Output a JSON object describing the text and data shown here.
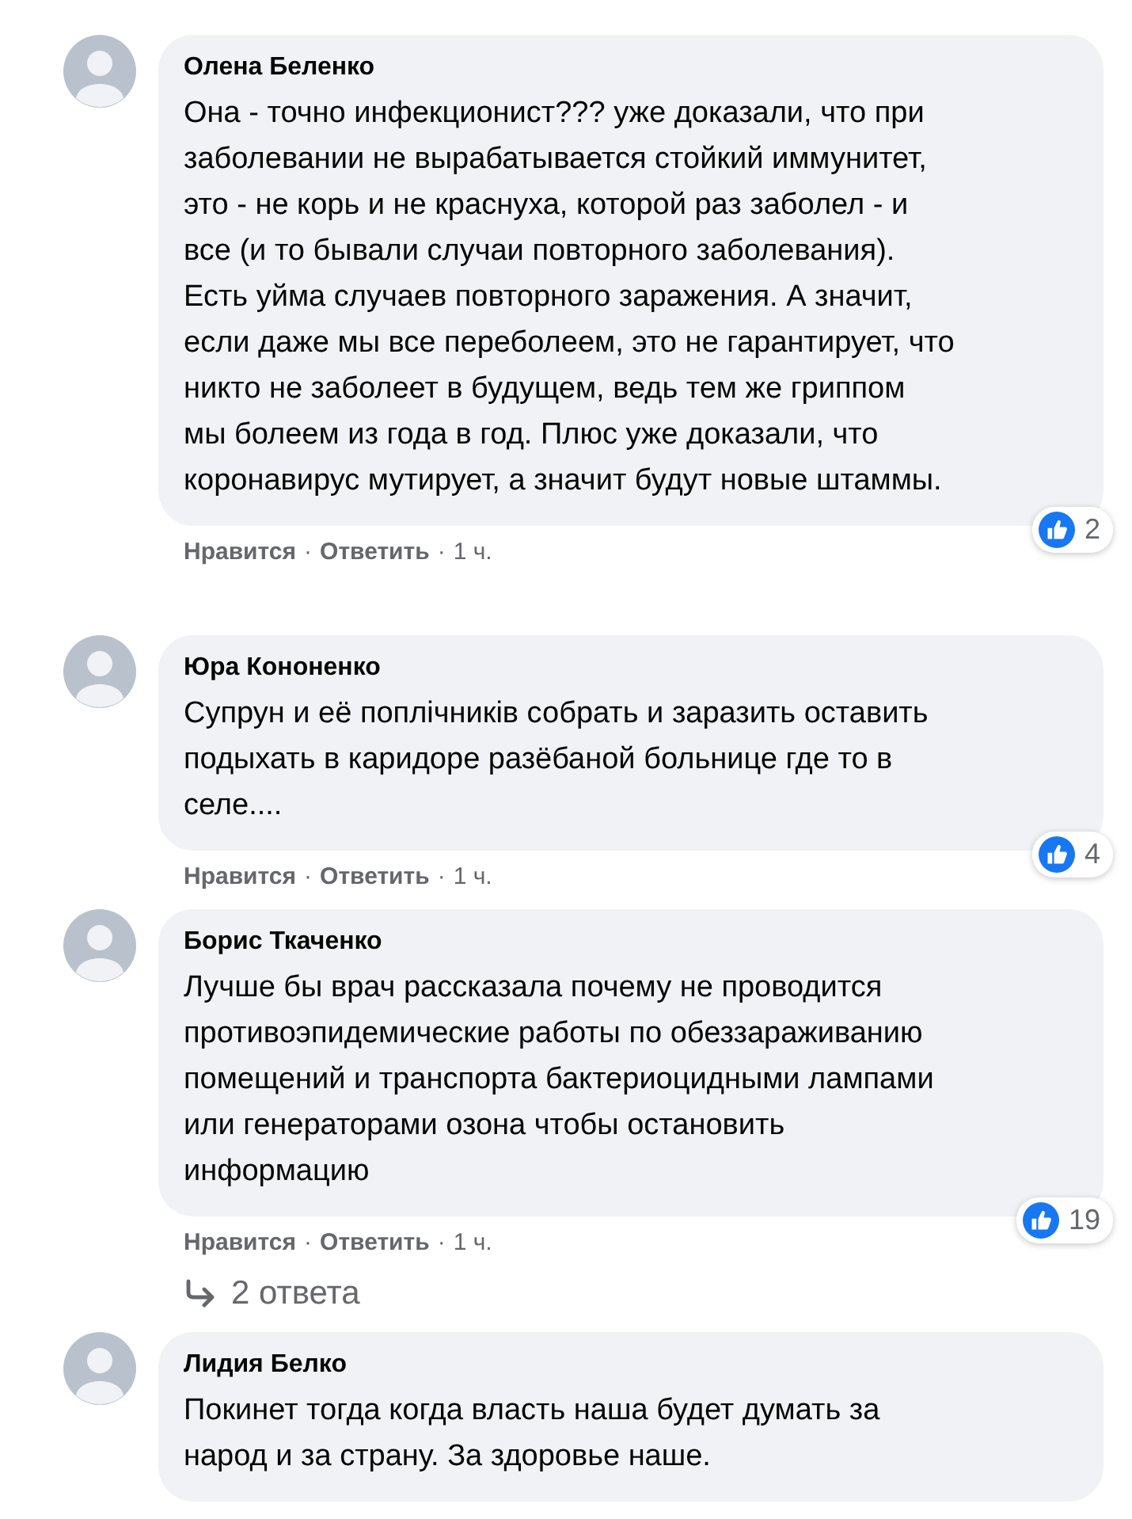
{
  "comments": [
    {
      "author": "Олена Беленко",
      "text": "Она - точно инфекционист??? уже доказали, что при\nзаболевании не вырабатывается стойкий иммунитет,\nэто - не корь и не краснуха, которой раз заболел - и\nвсе (и то бывали случаи повторного заболевания).\nЕсть уйма случаев повторного заражения. А значит,\nесли даже мы все переболеем, это не гарантирует, что\nникто не заболеет в будущем, ведь тем же гриппом\nмы болеем из года в год. Плюс уже доказали, что\nкоронавирус мутирует, а значит будут новые штаммы.",
      "reactions": "2",
      "actions": [
        {
          "kind": "like",
          "text": "Нравится"
        },
        {
          "kind": "separator",
          "text": "·"
        },
        {
          "kind": "reply",
          "text": "Ответить"
        },
        {
          "kind": "separator",
          "text": "·"
        },
        {
          "kind": "time",
          "text": "1 ч."
        }
      ]
    },
    {
      "author": "Юра Кононенко",
      "text": "Супрун и её поплічників собрать и заразить оставить\nподыхать в каридоре разёбаной больнице где то в\nселе....",
      "reactions": "4",
      "actions": [
        {
          "kind": "like",
          "text": "Нравится"
        },
        {
          "kind": "separator",
          "text": "·"
        },
        {
          "kind": "reply",
          "text": "Ответить"
        },
        {
          "kind": "separator",
          "text": "·"
        },
        {
          "kind": "time",
          "text": "1 ч."
        }
      ]
    },
    {
      "author": "Борис Ткаченко",
      "text": "Лучше бы врач рассказала почему не проводится\nпротивоэпидемические работы по обеззараживанию\nпомещений и транспорта бактериоцидными лампами\nили генераторами озона чтобы остановить\nинформацию",
      "reactions": "19",
      "actions": [
        {
          "kind": "like",
          "text": "Нравится"
        },
        {
          "kind": "separator",
          "text": "·"
        },
        {
          "kind": "reply",
          "text": "Ответить"
        },
        {
          "kind": "separator",
          "text": "·"
        },
        {
          "kind": "time",
          "text": "1 ч."
        }
      ],
      "replies": "2 ответа"
    },
    {
      "author": "Лидия Белко",
      "text": "Покинет тогда когда власть наша будет думать за\nнарод и за страну. За здоровье наше."
    }
  ]
}
